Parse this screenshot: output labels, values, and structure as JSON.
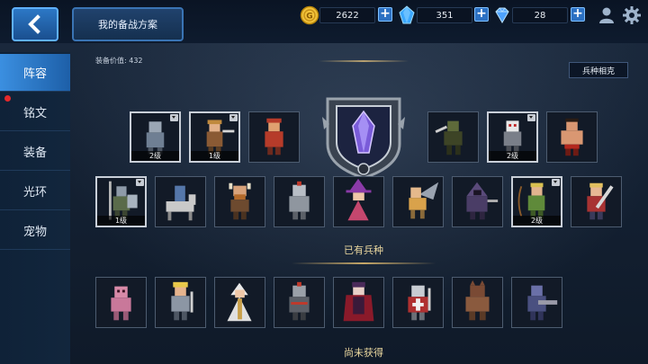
{
  "header": {
    "plan_label": "我的备战方案",
    "gold": "2622",
    "crystal": "351",
    "diamond": "28",
    "icons": [
      "back-arrow-icon",
      "gold-coin-icon",
      "blue-crystal-icon",
      "diamond-icon",
      "profile-icon",
      "gear-icon"
    ]
  },
  "sidebar": {
    "items": [
      {
        "label": "阵容",
        "active": true
      },
      {
        "label": "铭文",
        "badge": true
      },
      {
        "label": "装备"
      },
      {
        "label": "光环"
      },
      {
        "label": "宠物"
      }
    ]
  },
  "main": {
    "equip_value_label": "装备价值: 432",
    "counter_button": "兵种相克",
    "lineup_row1_levels": [
      "2级",
      "1级",
      "",
      "",
      "2级",
      ""
    ],
    "lineup_row2_levels": [
      "1级",
      "",
      "",
      "",
      "",
      "",
      "",
      "2级",
      ""
    ],
    "owned_title": "已有兵种",
    "unowned_title": "尚未获得"
  },
  "colors": {
    "accent": "#3b8fe0",
    "gold": "#e6b32c",
    "section_title": "#ecd9a0"
  }
}
